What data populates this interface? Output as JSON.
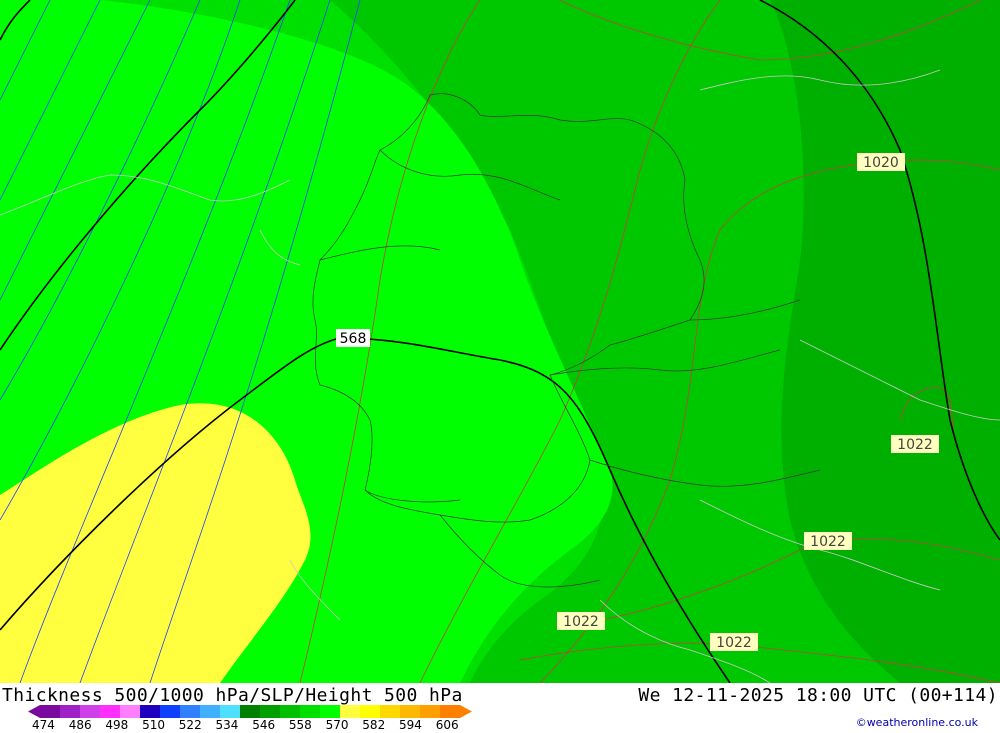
{
  "map": {
    "slp_labels": [
      "1020",
      "1022",
      "1022",
      "1022",
      "1022"
    ],
    "height_label": "568",
    "colors": {
      "band_554": "#00ff00",
      "band_558": "#00e000",
      "band_562": "#00c800",
      "band_566": "#00b000",
      "band_570": "#ffff40",
      "height_contour": "#000000",
      "slp_contour": "#c04040",
      "thickness_contour": "#2040ff",
      "borders": "#333333"
    }
  },
  "footer": {
    "title": "Thickness 500/1000 hPa/SLP/Height 500 hPa",
    "datetime": "We 12-11-2025 18:00 UTC (00+114)",
    "credit": "©weatheronline.co.uk",
    "legend_labels": [
      "474",
      "486",
      "498",
      "510",
      "522",
      "534",
      "546",
      "558",
      "570",
      "582",
      "594",
      "606"
    ],
    "legend_colors": [
      "#7a0a9e",
      "#a020c8",
      "#d040e8",
      "#ff30ff",
      "#ff80ff",
      "#2000c0",
      "#1040ff",
      "#3080ff",
      "#40b0ff",
      "#50e0ff",
      "#008000",
      "#00a000",
      "#00c000",
      "#00e000",
      "#00ff00",
      "#ffff40",
      "#ffff00",
      "#ffd800",
      "#ffb800",
      "#ffa000",
      "#ff8000"
    ]
  }
}
